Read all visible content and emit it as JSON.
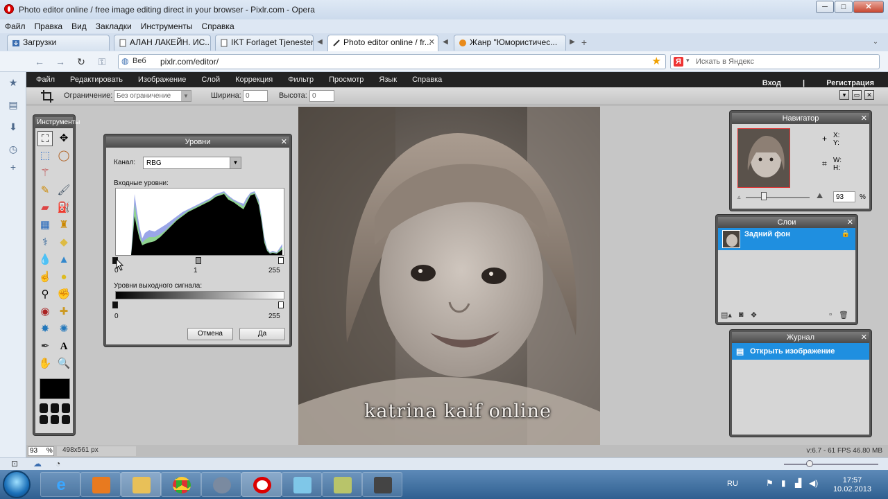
{
  "window": {
    "title": "Photo editor online / free image editing direct in your browser - Pixlr.com - Opera",
    "min": "─",
    "max": "□",
    "close": "✕"
  },
  "menu": [
    "Файл",
    "Правка",
    "Вид",
    "Закладки",
    "Инструменты",
    "Справка"
  ],
  "tabs": [
    {
      "label": "Загрузки",
      "active": false
    },
    {
      "label": "АЛАН ЛАКЕЙН. ИС...",
      "active": false
    },
    {
      "label": "IKT Forlaget Tjenester",
      "active": false
    },
    {
      "label": "Photo editor online / fr...",
      "active": true
    },
    {
      "label": "Жанр \"Юмористичес...",
      "active": false
    }
  ],
  "address": {
    "web_label": "Веб",
    "url": "pixlr.com/editor/",
    "search_placeholder": "Искать в Яндекс"
  },
  "pixlr": {
    "menu": [
      "Файл",
      "Редактировать",
      "Изображение",
      "Слой",
      "Коррекция",
      "Фильтр",
      "Просмотр",
      "Язык",
      "Справка"
    ],
    "auth": {
      "login": "Вход",
      "sep": "|",
      "register": "Регистрация"
    },
    "options": {
      "constraint_label": "Ограничение:",
      "constraint_value": "Без ограничение",
      "width_label": "Ширина:",
      "width_value": "0",
      "height_label": "Высота:",
      "height_value": "0"
    },
    "tools_title": "Инструменты",
    "levels": {
      "title": "Уровни",
      "channel_label": "Канал:",
      "channel_value": "RBG",
      "input_label": "Входные уровни:",
      "input_ticks": [
        "0",
        "1",
        "255"
      ],
      "output_label": "Уровни выходного сигнала:",
      "output_ticks": [
        "0",
        "255"
      ],
      "cancel": "Отмена",
      "ok": "Да"
    },
    "photo_caption": "katrina kaif online",
    "navigator": {
      "title": "Навигатор",
      "x": "X:",
      "y": "Y:",
      "w": "W:",
      "h": "H:",
      "zoom": "93",
      "percent": "%"
    },
    "layers": {
      "title": "Слои",
      "items": [
        "Задний фон"
      ]
    },
    "journal": {
      "title": "Журнал",
      "items": [
        "Открыть изображение"
      ]
    },
    "status": {
      "zoom": "93",
      "percent": "%",
      "size": "498x561 px",
      "fps": "v:6.7 - 61 FPS 46.80 MB"
    }
  },
  "taskbar": {
    "lang": "RU",
    "time": "17:57",
    "date": "10.02.2013"
  }
}
